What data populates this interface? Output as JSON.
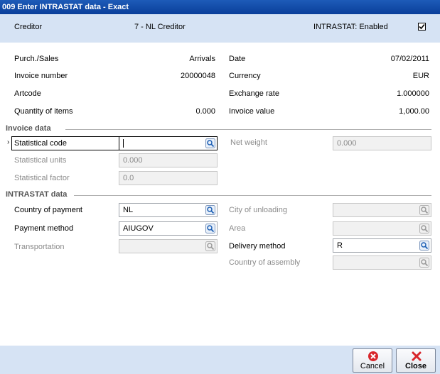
{
  "window": {
    "title": "009 Enter INTRASTAT data - Exact"
  },
  "header": {
    "creditor_label": "Creditor",
    "creditor_value": "7 - NL Creditor",
    "intrastat_status": "INTRASTAT: Enabled",
    "intrastat_checked": true
  },
  "info": {
    "purch_sales_label": "Purch./Sales",
    "purch_sales_value": "Arrivals",
    "invoice_number_label": "Invoice number",
    "invoice_number_value": "20000048",
    "artcode_label": "Artcode",
    "quantity_label": "Quantity of items",
    "quantity_value": "0.000",
    "date_label": "Date",
    "date_value": "07/02/2011",
    "currency_label": "Currency",
    "currency_value": "EUR",
    "exchange_rate_label": "Exchange rate",
    "exchange_rate_value": "1.000000",
    "invoice_value_label": "Invoice value",
    "invoice_value_value": "1,000.00"
  },
  "invoice_data": {
    "section_title": "Invoice data",
    "statistical_code_label": "Statistical code",
    "statistical_code_value": "",
    "statistical_units_label": "Statistical units",
    "statistical_units_value": "0.000",
    "statistical_factor_label": "Statistical factor",
    "statistical_factor_value": "0.0",
    "net_weight_label": "Net weight",
    "net_weight_value": "0.000"
  },
  "intrastat_data": {
    "section_title": "INTRASTAT data",
    "country_of_payment_label": "Country of payment",
    "country_of_payment_value": "NL",
    "payment_method_label": "Payment method",
    "payment_method_value": "AIUGOV",
    "transportation_label": "Transportation",
    "transportation_value": "",
    "city_of_unloading_label": "City of unloading",
    "city_of_unloading_value": "",
    "area_label": "Area",
    "area_value": "",
    "delivery_method_label": "Delivery method",
    "delivery_method_value": "R",
    "country_of_assembly_label": "Country of assembly",
    "country_of_assembly_value": ""
  },
  "buttons": {
    "cancel_label": "Cancel",
    "close_label": "Close"
  },
  "colors": {
    "title_bar": "#0a3f9a",
    "panel_band": "#d6e3f4",
    "cancel_icon": "#d8262b",
    "close_icon": "#d8262b"
  }
}
